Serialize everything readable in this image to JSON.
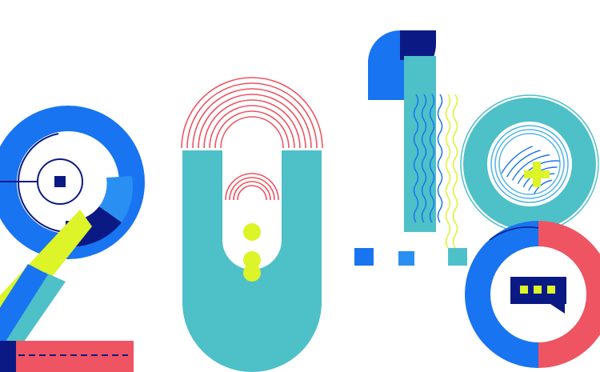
{
  "artwork": {
    "digits": [
      "2",
      "0",
      "1",
      "8"
    ],
    "style": "geometric flat illustration",
    "colors": {
      "background": "#ffffff",
      "royal_blue": "#1874f0",
      "sky_blue": "#2a8ff2",
      "navy": "#0b1985",
      "teal": "#4ec0c8",
      "coral": "#ee5461",
      "lime": "#dcf428",
      "light_blue": "#4fb3e8"
    }
  }
}
